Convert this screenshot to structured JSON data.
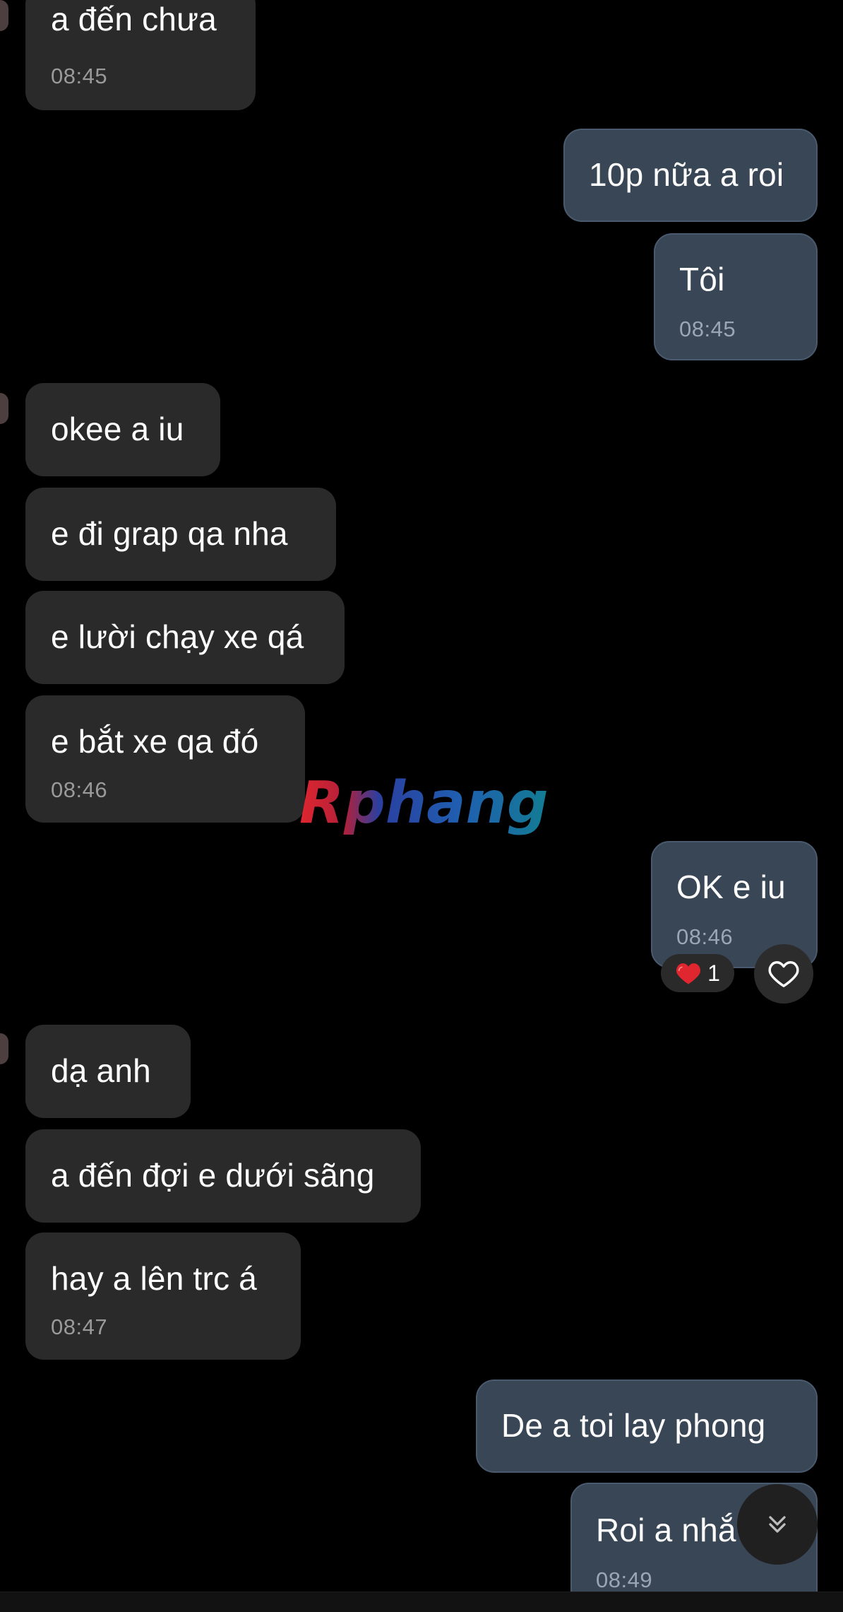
{
  "messages": [
    {
      "text": "a đến chưa",
      "time": "08:45"
    },
    {
      "text": "10p nữa a roi"
    },
    {
      "text": "Tôi",
      "time": "08:45"
    },
    {
      "text": "okee a iu"
    },
    {
      "text": "e đi grap qa nha"
    },
    {
      "text": "e lười chạy xe qá"
    },
    {
      "text": "e bắt xe qa đó",
      "time": "08:46"
    },
    {
      "text": "OK e iu",
      "time": "08:46"
    },
    {
      "text": "dạ anh"
    },
    {
      "text": "a đến đợi e dưới sãng"
    },
    {
      "text": "hay a lên trc á",
      "time": "08:47"
    },
    {
      "text": "De a toi lay phong"
    },
    {
      "text": "Roi a nhắ",
      "time": "08:49"
    }
  ],
  "reaction": {
    "emoji": "heart-red",
    "count": "1"
  },
  "watermark": {
    "text": "Rphang"
  },
  "icons": {
    "react": "heart-outline-icon",
    "scroll": "chevrons-down-icon"
  },
  "colors": {
    "background": "#000000",
    "incoming_bubble": "#2a2a2a",
    "outgoing_bubble": "#394656",
    "outgoing_border": "#4a5a6e",
    "time_text": "#9a9a9a",
    "heart": "#e0262f"
  }
}
